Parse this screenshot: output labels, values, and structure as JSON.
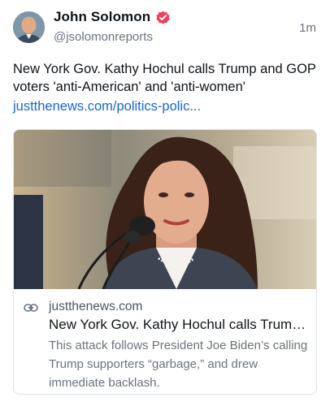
{
  "post": {
    "author_name": "John Solomon",
    "handle": "@jsolomonreports",
    "time": "1m",
    "text": "New York Gov. Kathy Hochul calls Trump and GOP voters 'anti-American' and 'anti-women'",
    "link_text": "justthenews.com/politics-polic...",
    "verified_icon": "verified-check-icon",
    "verified_color": "#ef3e5c",
    "link_color": "#1666d8"
  },
  "card": {
    "domain": "justthenews.com",
    "title": "New York Gov. Kathy Hochul calls Trump and GOP voters 'anti-American' and 'anti-women'",
    "description": "This attack follows President Joe Biden’s calling Trump supporters “garbage,” and drew immediate backlash.",
    "link_icon": "link-icon"
  }
}
